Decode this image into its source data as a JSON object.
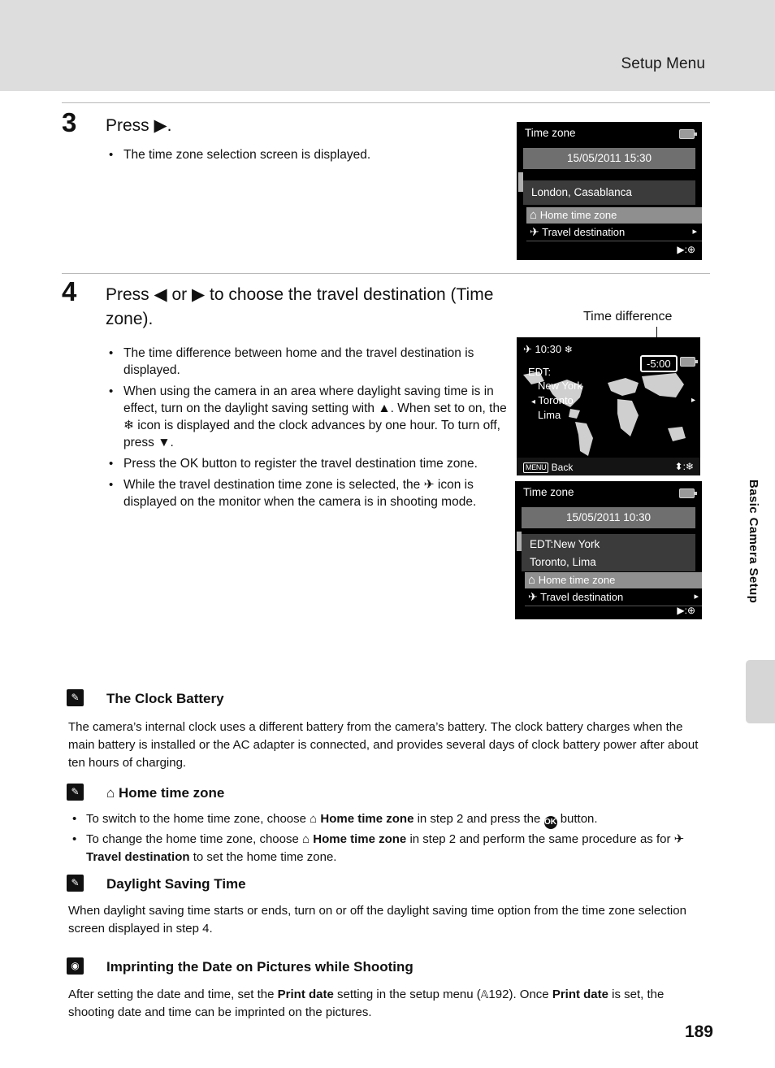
{
  "header": {
    "title": "Setup Menu"
  },
  "side_tab": {
    "text": "Basic Camera Setup"
  },
  "page_number": "189",
  "steps": [
    {
      "number": "3",
      "title": "Press ▶.",
      "bullets": [
        "The time zone selection screen is displayed."
      ]
    },
    {
      "number": "4",
      "title": "Press ◀ or ▶ to choose the travel destination (Time zone).",
      "bullets": [
        "The time difference between home and the travel destination is displayed.",
        "When using the camera in an area where daylight saving time is in effect, turn on the daylight saving setting with ▲. When set to on, the ❄ icon is displayed and the clock advances by one hour. To turn off, press ▼.",
        "Press the OK button to register the travel destination time zone.",
        "While the travel destination time zone is selected, the ✈ icon is displayed on the monitor when the camera is in shooting mode."
      ]
    }
  ],
  "screens": {
    "time_zone_home": {
      "title": "Time zone",
      "date": "15/05/2011  15:30",
      "city": "London, Casablanca",
      "row_home": "Home time zone",
      "row_travel": "Travel destination",
      "footer": "▶:⊕"
    },
    "travel_map": {
      "time": "10:30",
      "offset": "-5:00",
      "zone_code": "EDT:",
      "cities": [
        "New York",
        "Toronto",
        "Lima"
      ],
      "back_label": "Back",
      "back_badge": "MENU",
      "footer": "⬍:❄"
    },
    "time_zone_travel": {
      "title": "Time zone",
      "date": "15/05/2011  10:30",
      "city_line1": "EDT:New York",
      "city_line2": "Toronto, Lima",
      "row_home": "Home time zone",
      "row_travel": "Travel destination",
      "footer": "▶:⊕"
    }
  },
  "annotations": {
    "time_difference": "Time difference"
  },
  "notes": [
    {
      "id": "clock-battery",
      "icon": "pencil-icon",
      "heading": "The Clock Battery",
      "body": "The camera’s internal clock uses a different battery from the camera’s battery. The clock battery charges when the main battery is installed or the AC adapter is connected, and provides several days of clock battery power after about ten hours of charging."
    },
    {
      "id": "home-time-zone",
      "icon": "pencil-icon",
      "heading": "Home time zone",
      "heading_glyph": "⌂",
      "bullets": [
        "To switch to the home time zone, choose ⌂ Home time zone in step 2 and press the OK button.",
        "To change the home time zone, choose ⌂ Home time zone in step 2 and perform the same procedure as for ✈ Travel destination to set the home time zone."
      ]
    },
    {
      "id": "daylight-saving-time",
      "icon": "pencil-icon",
      "heading": "Daylight Saving Time",
      "body": "When daylight saving time starts or ends, turn on or off the daylight saving time option from the time zone selection screen displayed in step 4."
    },
    {
      "id": "imprinting-date",
      "icon": "camera-icon",
      "heading": "Imprinting the Date on Pictures while Shooting",
      "body": "After setting the date and time, set the Print date setting in the setup menu (A192). Once Print date is set, the shooting date and time can be imprinted on the pictures."
    }
  ]
}
